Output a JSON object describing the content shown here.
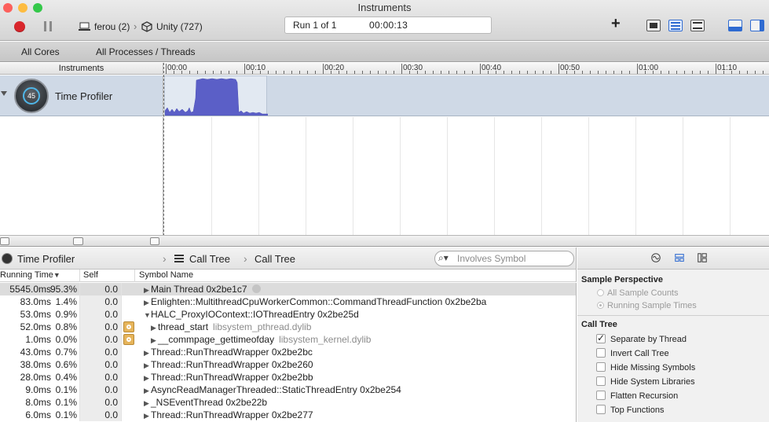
{
  "window": {
    "title": "Instruments",
    "traffic_lights": [
      "#fc605c",
      "#fdbc40",
      "#34c84a"
    ]
  },
  "toolbar": {
    "device_label": "ferou (2)",
    "target_label": "Unity (727)",
    "run_label": "Run 1 of 1",
    "run_time": "00:00:13",
    "add_label": "+"
  },
  "scope": {
    "cores": "All Cores",
    "processes": "All Processes / Threads"
  },
  "timeline": {
    "header": "Instruments",
    "ticks": [
      "00:00",
      "00:10",
      "00:20",
      "00:30",
      "00:40",
      "00:50",
      "01:00",
      "01:10"
    ]
  },
  "track": {
    "name": "Time Profiler",
    "gauge_value": "45"
  },
  "detail": {
    "instrument": "Time Profiler",
    "crumb1": "Call Tree",
    "crumb2": "Call Tree",
    "search_placeholder": "Involves Symbol",
    "columns": {
      "running_time": "Running Time",
      "self": "Self",
      "symbol": "Symbol Name"
    },
    "rows": [
      {
        "rt": "5545.0ms",
        "pct": "95.3%",
        "self": "0.0",
        "sym": "Main Thread  0x2be1c7",
        "lib": "",
        "indent": 0,
        "tri": "▶",
        "gear": false,
        "sel": true,
        "arrow": true
      },
      {
        "rt": "83.0ms",
        "pct": "1.4%",
        "self": "0.0",
        "sym": "Enlighten::MultithreadCpuWorkerCommon::CommandThreadFunction  0x2be2ba",
        "lib": "",
        "indent": 0,
        "tri": "▶",
        "gear": false,
        "sel": false,
        "arrow": false
      },
      {
        "rt": "53.0ms",
        "pct": "0.9%",
        "self": "0.0",
        "sym": "HALC_ProxyIOContext::IOThreadEntry  0x2be25d",
        "lib": "",
        "indent": 0,
        "tri": "▼",
        "gear": false,
        "sel": false,
        "arrow": false
      },
      {
        "rt": "52.0ms",
        "pct": "0.8%",
        "self": "0.0",
        "sym": "thread_start",
        "lib": "libsystem_pthread.dylib",
        "indent": 1,
        "tri": "▶",
        "gear": true,
        "sel": false,
        "arrow": false
      },
      {
        "rt": "1.0ms",
        "pct": "0.0%",
        "self": "0.0",
        "sym": "__commpage_gettimeofday",
        "lib": "libsystem_kernel.dylib",
        "indent": 1,
        "tri": "▶",
        "gear": true,
        "sel": false,
        "arrow": false
      },
      {
        "rt": "43.0ms",
        "pct": "0.7%",
        "self": "0.0",
        "sym": "Thread::RunThreadWrapper  0x2be2bc",
        "lib": "",
        "indent": 0,
        "tri": "▶",
        "gear": false,
        "sel": false,
        "arrow": false
      },
      {
        "rt": "38.0ms",
        "pct": "0.6%",
        "self": "0.0",
        "sym": "Thread::RunThreadWrapper  0x2be260",
        "lib": "",
        "indent": 0,
        "tri": "▶",
        "gear": false,
        "sel": false,
        "arrow": false
      },
      {
        "rt": "28.0ms",
        "pct": "0.4%",
        "self": "0.0",
        "sym": "Thread::RunThreadWrapper  0x2be2bb",
        "lib": "",
        "indent": 0,
        "tri": "▶",
        "gear": false,
        "sel": false,
        "arrow": false
      },
      {
        "rt": "9.0ms",
        "pct": "0.1%",
        "self": "0.0",
        "sym": "AsyncReadManagerThreaded::StaticThreadEntry  0x2be254",
        "lib": "",
        "indent": 0,
        "tri": "▶",
        "gear": false,
        "sel": false,
        "arrow": false
      },
      {
        "rt": "8.0ms",
        "pct": "0.1%",
        "self": "0.0",
        "sym": "_NSEventThread  0x2be22b",
        "lib": "",
        "indent": 0,
        "tri": "▶",
        "gear": false,
        "sel": false,
        "arrow": false
      },
      {
        "rt": "6.0ms",
        "pct": "0.1%",
        "self": "0.0",
        "sym": "Thread::RunThreadWrapper  0x2be277",
        "lib": "",
        "indent": 0,
        "tri": "▶",
        "gear": false,
        "sel": false,
        "arrow": false
      }
    ]
  },
  "inspector": {
    "sample_perspective": {
      "title": "Sample Perspective",
      "options": [
        {
          "label": "All Sample Counts",
          "selected": false
        },
        {
          "label": "Running Sample Times",
          "selected": true
        }
      ]
    },
    "call_tree": {
      "title": "Call Tree",
      "options": [
        {
          "label": "Separate by Thread",
          "checked": true
        },
        {
          "label": "Invert Call Tree",
          "checked": false
        },
        {
          "label": "Hide Missing Symbols",
          "checked": false
        },
        {
          "label": "Hide System Libraries",
          "checked": false
        },
        {
          "label": "Flatten Recursion",
          "checked": false
        },
        {
          "label": "Top Functions",
          "checked": false
        }
      ]
    }
  },
  "colors": {
    "record": "#d9262c",
    "graph": "#5b5fc7",
    "track_bg": "#cfd9e6",
    "view_active": "#2f6bd1"
  }
}
